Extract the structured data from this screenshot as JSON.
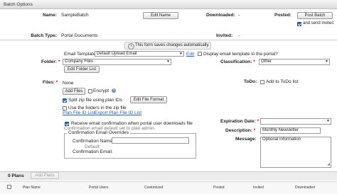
{
  "panel": {
    "title": "Batch Options"
  },
  "header": {
    "name_label": "Name:",
    "name_value": "SampleBatch",
    "edit_name_button": "Edit Name",
    "downloaded_label": "Downloaded:",
    "downloaded_value": "-",
    "posted_label": "Posted:",
    "post_batch_button": "Post Batch",
    "send_invites_label": "and send invites",
    "batch_type_label": "Batch Type:",
    "batch_type_value": "Portal Documents",
    "invited_label": "Invited:",
    "invited_value": "-"
  },
  "info_message": "This form saves changes automatically.",
  "email_template": {
    "label": "Email Template:",
    "value": "Default Upload Email",
    "edit_link": "Edit",
    "display_label": "Display email template in the portal?"
  },
  "folder": {
    "label": "Folder:",
    "value": "Company Files",
    "edit_button": "Edit Folder List"
  },
  "classification": {
    "label": "Classification:",
    "value": "Other"
  },
  "files": {
    "label": "Files:",
    "value": "None",
    "add_button": "Add Files",
    "encrypt_label": "Encrypt",
    "split_label": "Split zip file using plan IDs",
    "edit_format_button": "Edit File Format",
    "use_folders_label": "Use the folders in the zip file",
    "plan_file_id_list_link": "Plan File ID List",
    "export_link": "Export Plan File ID List"
  },
  "todo": {
    "label": "ToDo:",
    "add_label": "Add to ToDo list"
  },
  "confirmation": {
    "receive_label": "Receive email confirmation when portal user downloads file",
    "default_note": "Confirmation email default set to plan admin.",
    "overrides_legend": "Confirmation Email Overrides",
    "name_label": "Confirmation Name:",
    "default_label": "Default:",
    "email_label": "Confirmation Email:"
  },
  "expiration": {
    "label": "Expiration Date:",
    "value": ""
  },
  "description": {
    "label": "Description:",
    "value": "Monthly Newsletter"
  },
  "message": {
    "label": "Message:",
    "value": "Optional Information"
  },
  "plans": {
    "count_label": "0 Plans",
    "add_button": "Add Plans",
    "columns": [
      "Plan Name",
      "Portal Users",
      "Customized",
      "Posted",
      "Invited",
      "Downloaded"
    ]
  }
}
